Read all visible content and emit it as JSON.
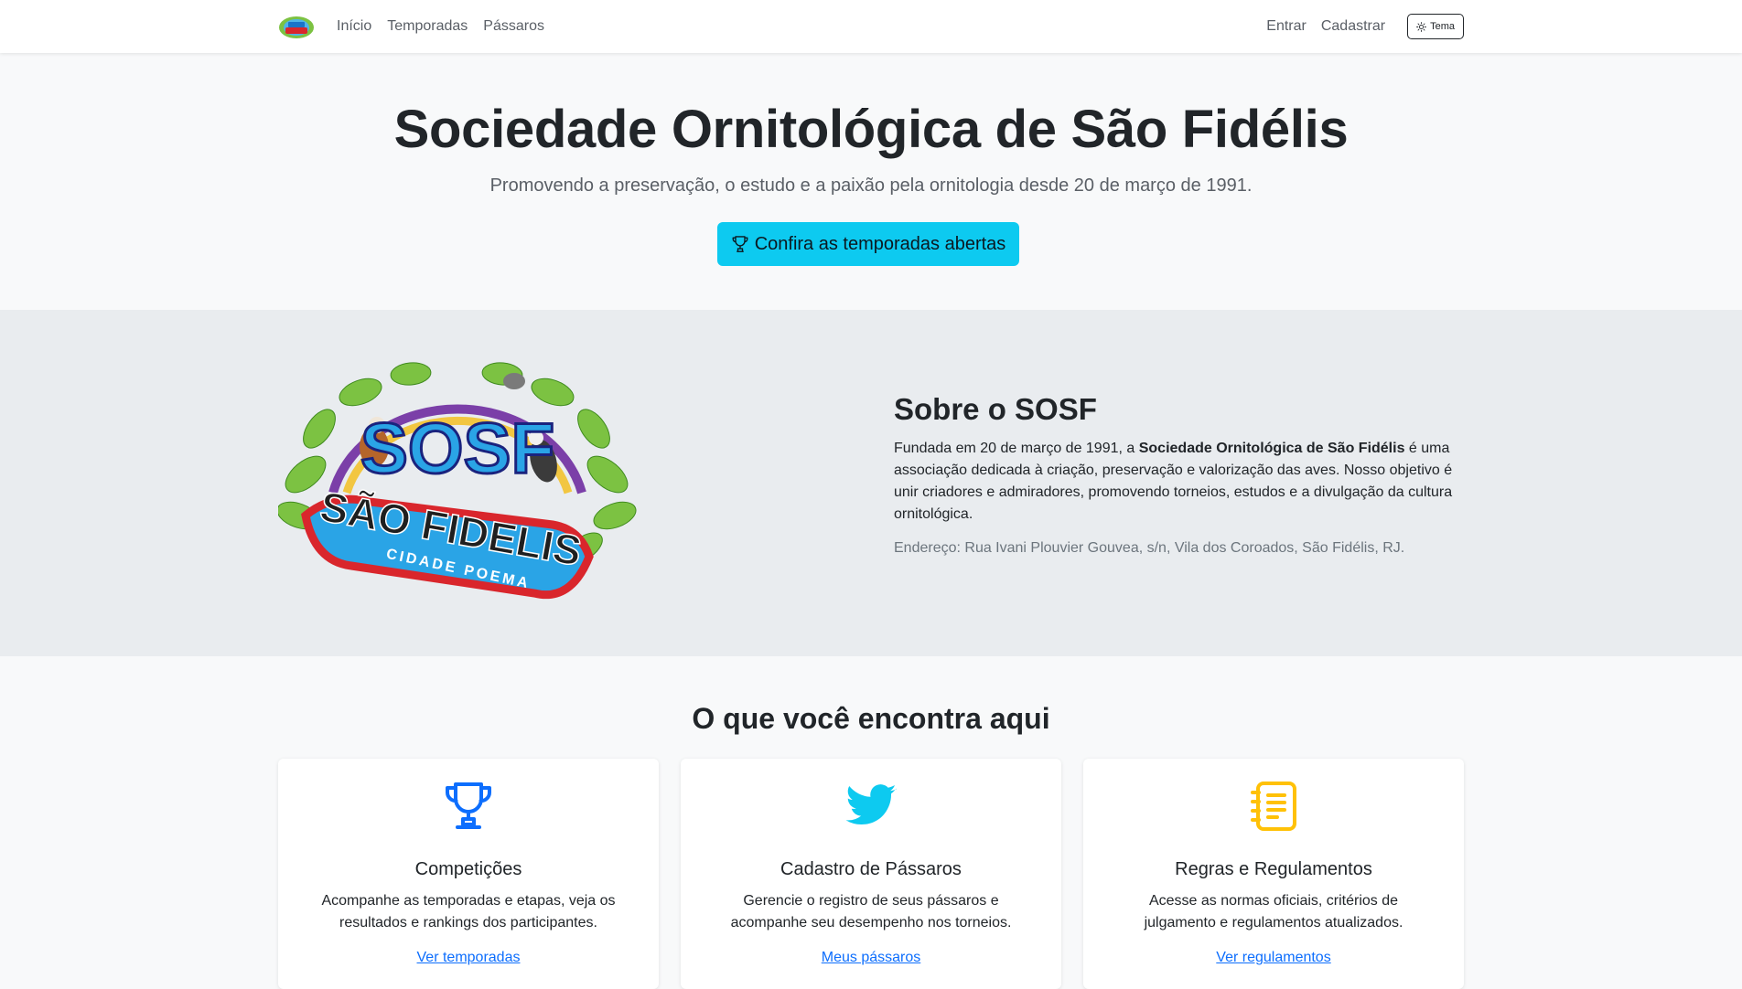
{
  "nav": {
    "logo_icon": "sosf-small-logo",
    "links": [
      "Início",
      "Temporadas",
      "Pássaros"
    ],
    "login": "Entrar",
    "register": "Cadastrar",
    "theme_label": "Tema",
    "theme_icon": "sun-icon"
  },
  "hero": {
    "title": "Sociedade Ornitológica de São Fidélis",
    "subtitle": "Promovendo a preservação, o estudo e a paixão pela ornitologia desde 20 de março de 1991.",
    "button_label": "Confira as temporadas abertas",
    "button_icon": "trophy-icon",
    "button_color": "#0dcaf0"
  },
  "about": {
    "logo_text": {
      "main": "SOSF",
      "banner": "SÃO FIDELIS",
      "ribbon": "CIDADE POEMA"
    },
    "title": "Sobre o SOSF",
    "desc_prefix": "Fundada em 20 de março de 1991, a ",
    "desc_bold": "Sociedade Ornitológica de São Fidélis",
    "desc_suffix": " é uma associação dedicada à criação, preservação e valorização das aves. Nosso objetivo é unir criadores e admiradores, promovendo torneios, estudos e a divulgação da cultura ornitológica.",
    "address": "Endereço: Rua Ivani Plouvier Gouvea, s/n, Vila dos Coroados, São Fidélis, RJ."
  },
  "features": {
    "title": "O que você encontra aqui",
    "cards": [
      {
        "icon": "trophy-icon",
        "icon_color": "#0d6efd",
        "title": "Competições",
        "text": "Acompanhe as temporadas e etapas, veja os resultados e rankings dos participantes.",
        "link": "Ver temporadas"
      },
      {
        "icon": "twitter-bird-icon",
        "icon_color": "#0dcaf0",
        "title": "Cadastro de Pássaros",
        "text": "Gerencie o registro de seus pássaros e acompanhe seu desempenho nos torneios.",
        "link": "Meus pássaros"
      },
      {
        "icon": "journal-text-icon",
        "icon_color": "#ffc107",
        "title": "Regras e Regulamentos",
        "text": "Acesse as normas oficiais, critérios de julgamento e regulamentos atualizados.",
        "link": "Ver regulamentos"
      }
    ]
  }
}
